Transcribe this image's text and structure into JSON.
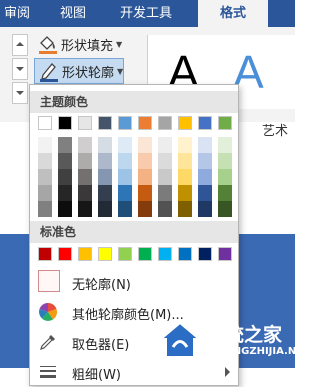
{
  "tabs": [
    {
      "label": "审阅",
      "active": false
    },
    {
      "label": "视图",
      "active": false
    },
    {
      "label": "开发工具",
      "active": false
    },
    {
      "label": "格式",
      "active": true
    }
  ],
  "ribbon": {
    "shape_fill_label": "形状填充",
    "shape_outline_label": "形状轮廓",
    "art_group_label": "艺术",
    "art_letter": "A",
    "colors": {
      "accent": "#2b579a",
      "fill_bucket": "#e77d2e",
      "outline_pen": "#2b579a"
    }
  },
  "menu": {
    "theme_colors_header": "主题颜色",
    "standard_colors_header": "标准色",
    "no_outline_label": "无轮廓(N)",
    "more_colors_label": "其他轮廓颜色(M)...",
    "eyedropper_label": "取色器(E)",
    "weight_label": "粗细(W)",
    "theme_base_colors": [
      "#ffffff",
      "#000000",
      "#e7e6e6",
      "#44546a",
      "#5b9bd5",
      "#ed7d31",
      "#a5a5a5",
      "#ffc000",
      "#4472c4",
      "#70ad47"
    ],
    "theme_shades": [
      [
        "#f2f2f2",
        "#d9d9d9",
        "#bfbfbf",
        "#a6a6a6",
        "#808080"
      ],
      [
        "#808080",
        "#595959",
        "#404040",
        "#262626",
        "#0d0d0d"
      ],
      [
        "#d0cece",
        "#aeabab",
        "#757070",
        "#3a3838",
        "#171616"
      ],
      [
        "#d6dce4",
        "#adb9ca",
        "#8496b0",
        "#333f4f",
        "#222a35"
      ],
      [
        "#deebf6",
        "#bdd7ee",
        "#9dc3e6",
        "#2e75b5",
        "#1f4e79"
      ],
      [
        "#fbe5d5",
        "#f7cbac",
        "#f4b183",
        "#c55a11",
        "#843c0c"
      ],
      [
        "#ededed",
        "#dbdbdb",
        "#c9c9c9",
        "#7b7b7b",
        "#525252"
      ],
      [
        "#fff2cc",
        "#fee599",
        "#ffd965",
        "#bf9000",
        "#7f6000"
      ],
      [
        "#dae3f3",
        "#b4c7e7",
        "#8faadc",
        "#2f5597",
        "#203864"
      ],
      [
        "#e2efd9",
        "#c5e0b3",
        "#a8d08d",
        "#538135",
        "#375623"
      ]
    ],
    "standard_colors": [
      "#c00000",
      "#ff0000",
      "#ffc000",
      "#ffff00",
      "#92d050",
      "#00b050",
      "#00b0f0",
      "#0070c0",
      "#002060",
      "#7030a0"
    ]
  },
  "watermark": {
    "text": "系统之家",
    "url": "XITONGZHIJIA.NET",
    "colors": {
      "logo_blue": "#2b6cc4"
    }
  }
}
